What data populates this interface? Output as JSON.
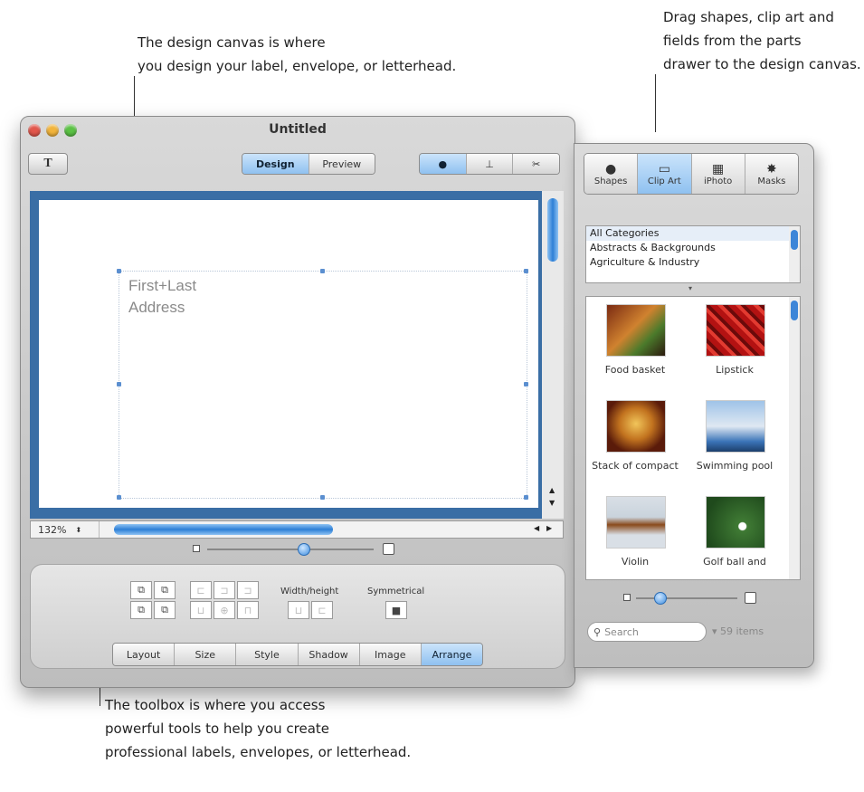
{
  "callouts": {
    "canvas": [
      "The design canvas is where",
      "you design your label, envelope, or letterhead."
    ],
    "drawer": [
      "Drag shapes, clip art and",
      "fields from the parts",
      "drawer to the design canvas."
    ],
    "toolbox": [
      "The toolbox is where you access",
      "powerful tools to help you create",
      "professional labels, envelopes, or letterhead."
    ]
  },
  "window": {
    "title": "Untitled",
    "text_button": "T",
    "mode_tabs": [
      "Design",
      "Preview"
    ],
    "tool_icons": [
      "●",
      "⊥",
      "✂"
    ],
    "canvas_text": [
      "First+Last",
      "Address"
    ],
    "zoom": "132%"
  },
  "toolbox": {
    "width_height_label": "Width/height",
    "symmetrical_label": "Symmetrical",
    "tabs": [
      "Layout",
      "Size",
      "Style",
      "Shadow",
      "Image",
      "Arrange"
    ],
    "active_tab": "Arrange"
  },
  "drawer": {
    "tabs": [
      {
        "label": "Shapes",
        "icon": "●"
      },
      {
        "label": "Clip Art",
        "icon": "▭"
      },
      {
        "label": "iPhoto",
        "icon": "▦"
      },
      {
        "label": "Masks",
        "icon": "✸"
      }
    ],
    "categories": [
      "All Categories",
      "Abstracts & Backgrounds",
      "Agriculture & Industry"
    ],
    "items": [
      "Food basket",
      "Lipstick",
      "Stack of compact",
      "Swimming pool",
      "Violin",
      "Golf ball and"
    ],
    "search_placeholder": "Search",
    "count": "▾ 59 items"
  },
  "colors": {
    "accent": "#8fc1f0",
    "canvas_border": "#3a6ea5"
  }
}
